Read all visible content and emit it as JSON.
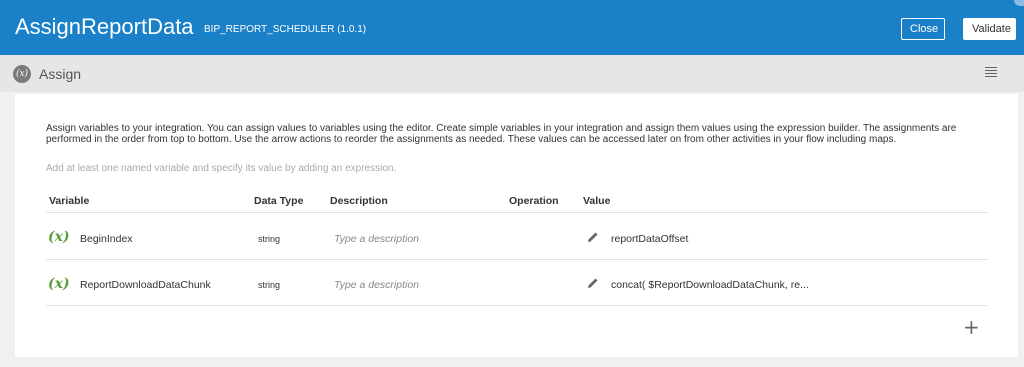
{
  "header": {
    "title": "AssignReportData",
    "subtitle": "BIP_REPORT_SCHEDULER (1.0.1)",
    "close_label": "Close",
    "validate_label": "Validate"
  },
  "section": {
    "badge": "(x)",
    "label": "Assign"
  },
  "intro": {
    "text": "Assign variables to your integration. You can assign values to variables using the editor. Create simple variables in your integration and assign them values using the expression builder. The assignments are performed in the order from top to bottom. Use the arrow actions to reorder the assignments as needed. These values can be accessed later on from other activities in your flow including maps.",
    "hint": "Add at least one named variable and specify its value by adding an expression."
  },
  "table": {
    "headers": {
      "variable": "Variable",
      "data_type": "Data Type",
      "description": "Description",
      "operation": "Operation",
      "value": "Value"
    },
    "rows": [
      {
        "icon": "(x)",
        "variable": "BeginIndex",
        "data_type": "string",
        "description_placeholder": "Type a description",
        "value": "reportDataOffset"
      },
      {
        "icon": "(x)",
        "variable": "ReportDownloadDataChunk",
        "data_type": "string",
        "description_placeholder": "Type a description",
        "value": "concat( $ReportDownloadDataChunk, re..."
      }
    ]
  },
  "add_label": "+",
  "icons": {
    "menu": "hamburger-menu-icon",
    "edit": "pencil-icon",
    "variable": "variable-x-icon"
  },
  "colors": {
    "header_bg": "#1a80c8",
    "variable_icon": "#5a9e3a"
  }
}
